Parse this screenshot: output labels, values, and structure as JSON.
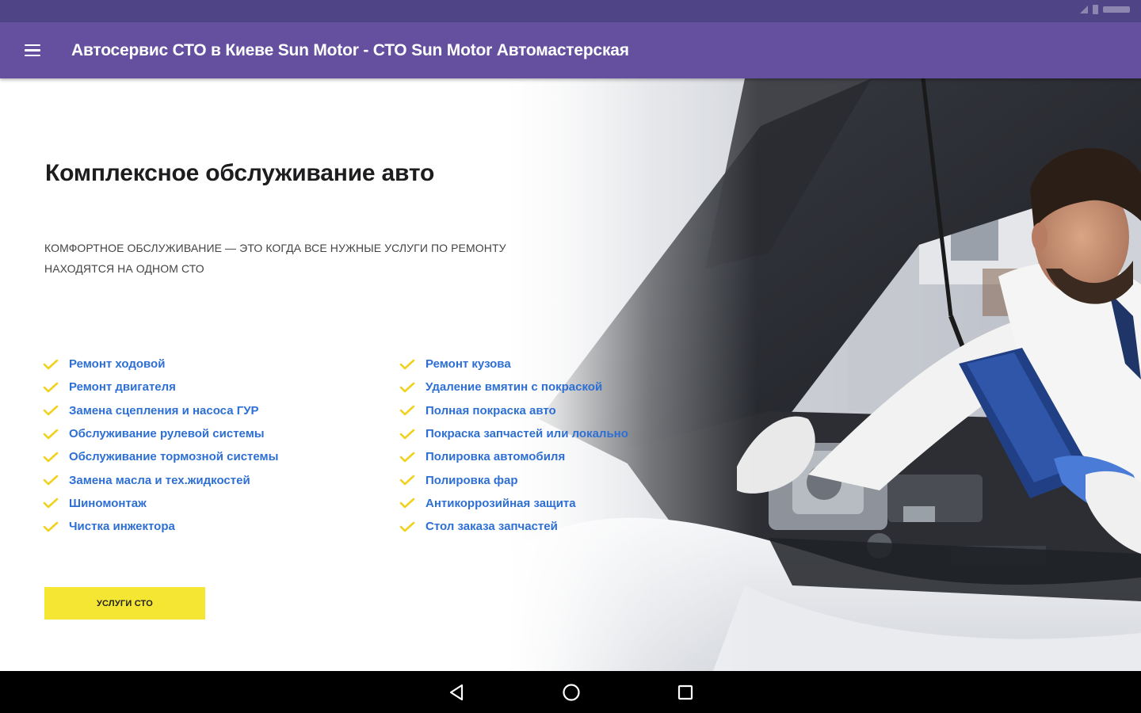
{
  "app": {
    "title": "Автосервис СТО в Киеве Sun Motor - СТО Sun Motor Автомастерская"
  },
  "hero": {
    "title": "Комплексное обслуживание авто",
    "subtitle": "КОМФОРТНОЕ ОБСЛУЖИВАНИЕ — ЭТО КОГДА ВСЕ НУЖНЫЕ УСЛУГИ ПО РЕМОНТУ НАХОДЯТСЯ НА ОДНОМ СТО"
  },
  "services_left": [
    "Ремонт ходовой",
    "Ремонт двигателя",
    "Замена сцепления и насоса ГУР",
    "Обслуживание рулевой системы",
    "Обслуживание тормозной системы",
    "Замена масла и тех.жидкостей",
    "Шиномонтаж",
    "Чистка инжектора"
  ],
  "services_right": [
    "Ремонт кузова",
    "Удаление вмятин с покраской",
    "Полная покраска авто",
    "Покраска запчастей или локально",
    "Полировка автомобиля",
    "Полировка фар",
    "Антикоррозийная защита",
    "Стол заказа запчастей"
  ],
  "cta": {
    "label": "УСЛУГИ СТО"
  },
  "colors": {
    "status_bar": "#4f4586",
    "app_bar": "#6550a0",
    "link": "#2d6fd4",
    "check": "#f0d21e",
    "cta": "#f6e634"
  },
  "icons": {
    "menu": "hamburger-menu-icon",
    "check": "checkmark-icon",
    "back": "back-triangle-icon",
    "home": "home-circle-icon",
    "recents": "recents-square-icon"
  }
}
